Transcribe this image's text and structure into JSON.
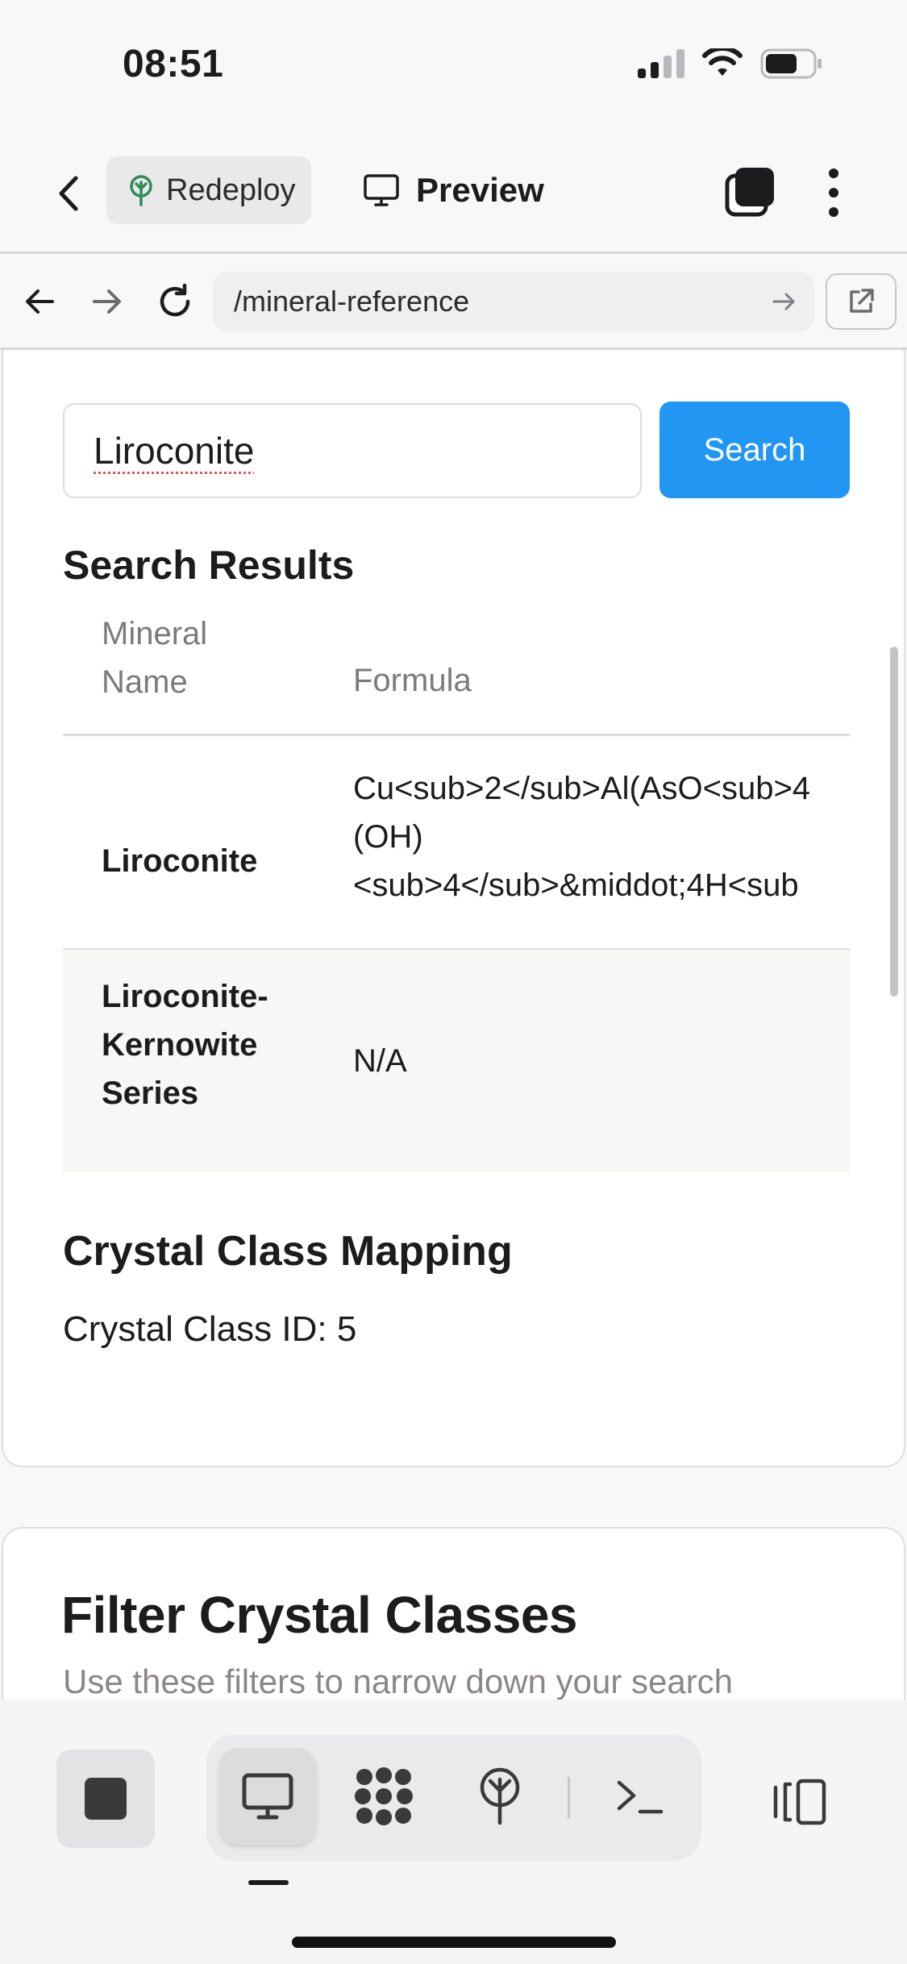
{
  "status_bar": {
    "time": "08:51"
  },
  "header": {
    "redeploy_label": "Redeploy",
    "preview_label": "Preview"
  },
  "browser": {
    "url": "/mineral-reference"
  },
  "search": {
    "value": "Liroconite",
    "button_label": "Search"
  },
  "results": {
    "title": "Search Results",
    "columns": [
      "Mineral Name",
      "Formula"
    ],
    "rows": [
      {
        "name": "Liroconite",
        "formula_lines": [
          "Cu<sub>2</sub>Al(AsO<sub>4",
          "(OH)",
          "<sub>4</sub>&middot;4H<sub"
        ]
      },
      {
        "name": "Liroconite-Kernowite Series",
        "formula": "N/A"
      }
    ]
  },
  "crystal_class": {
    "title": "Crystal Class Mapping",
    "id_text": "Crystal Class ID: 5"
  },
  "filter": {
    "title": "Filter Crystal Classes",
    "subtitle": "Use these filters to narrow down your search"
  },
  "colors": {
    "accent": "#2196f3",
    "text": "#1c1c1e",
    "muted": "#7d7a78"
  },
  "icons": {
    "header": [
      "chevron-left-icon",
      "tree-icon",
      "monitor-icon",
      "tabs-icon",
      "more-vertical-icon"
    ],
    "browser": [
      "arrow-left-icon",
      "arrow-right-icon",
      "reload-icon",
      "arrow-right-small-icon",
      "external-link-icon"
    ],
    "toolbar": [
      "stop-icon",
      "monitor-icon",
      "grid-dots-icon",
      "deploy-icon",
      "terminal-icon",
      "split-view-icon"
    ]
  }
}
